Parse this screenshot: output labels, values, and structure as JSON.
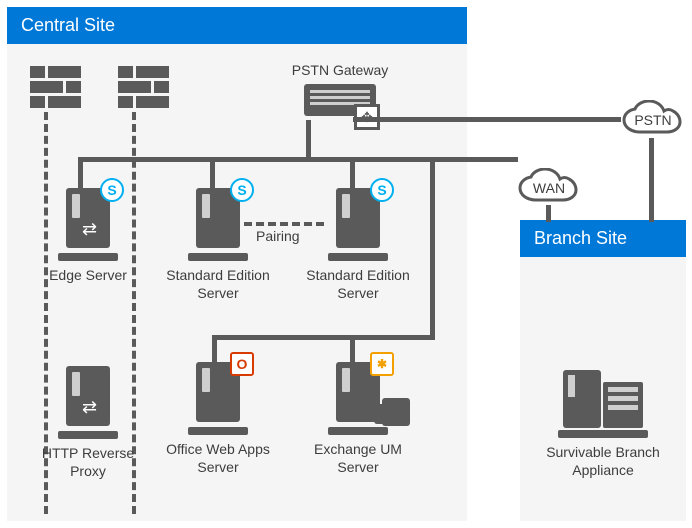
{
  "central": {
    "title": "Central Site"
  },
  "branch": {
    "title": "Branch Site"
  },
  "gateway": {
    "label": "PSTN Gateway"
  },
  "clouds": {
    "pstn": "PSTN",
    "wan": "WAN"
  },
  "pairing": "Pairing",
  "servers": {
    "edge": {
      "label": "Edge Server"
    },
    "se1": {
      "label": "Standard Edition Server"
    },
    "se2": {
      "label": "Standard Edition Server"
    },
    "proxy": {
      "label": "HTTP Reverse Proxy"
    },
    "owa": {
      "label": "Office Web Apps Server"
    },
    "exum": {
      "label": "Exchange UM Server"
    },
    "sba": {
      "label": "Survivable Branch Appliance"
    }
  }
}
